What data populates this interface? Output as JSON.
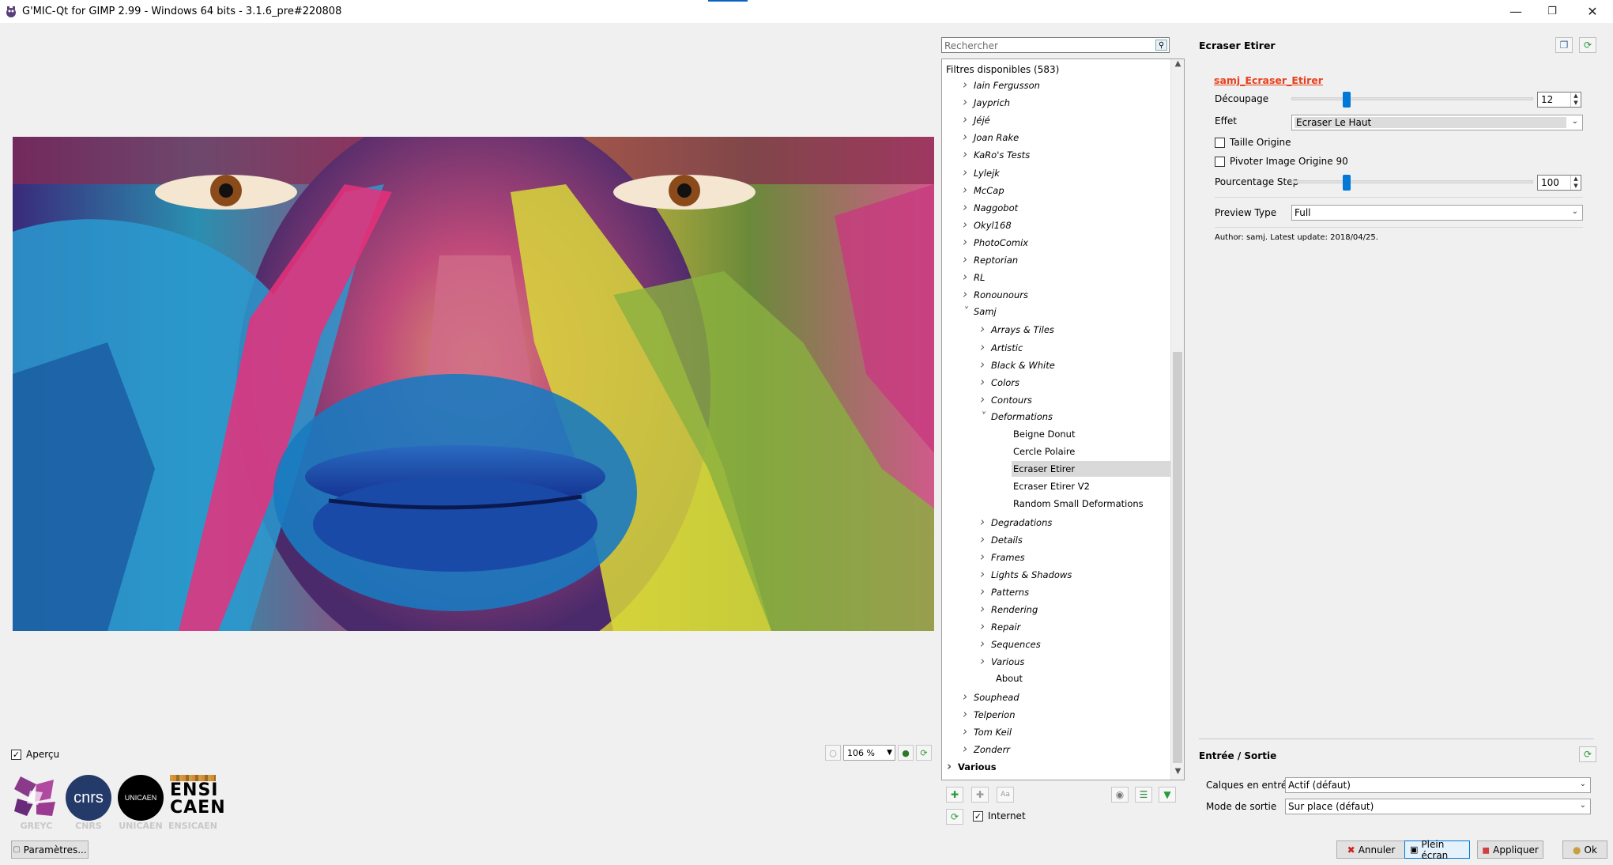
{
  "window": {
    "title": "G'MIC-Qt for GIMP 2.99 - Windows 64 bits - 3.1.6_pre#220808",
    "controls": [
      "minimize",
      "restore",
      "close"
    ]
  },
  "preview": {
    "apercu_label": "Aperçu",
    "apercu_checked": true,
    "zoom": "106 %"
  },
  "logos": {
    "greyc": "GREYC",
    "cnrs_text": "cnrs",
    "cnrs": "CNRS",
    "unicaen_text": "UNICAEN",
    "unicaen": "UNICAEN",
    "ensicaen_line1": "ENSI",
    "ensicaen_line2": "CAEN",
    "ensicaen": "ENSICAEN"
  },
  "buttons": {
    "settings": "Paramètres...",
    "cancel": "Annuler",
    "fullscreen": "Plein écran",
    "apply": "Appliquer",
    "ok": "Ok"
  },
  "filters": {
    "search_placeholder": "Rechercher",
    "header": "Filtres disponibles (583)",
    "internet_label": "Internet",
    "internet_checked": true,
    "rows": [
      {
        "label": "Iain Fergusson",
        "level": 1,
        "state": "collapsed"
      },
      {
        "label": "Jayprich",
        "level": 1,
        "state": "collapsed"
      },
      {
        "label": "Jéjé",
        "level": 1,
        "state": "collapsed"
      },
      {
        "label": "Joan Rake",
        "level": 1,
        "state": "collapsed"
      },
      {
        "label": "KaRo's Tests",
        "level": 1,
        "state": "collapsed"
      },
      {
        "label": "Lylejk",
        "level": 1,
        "state": "collapsed"
      },
      {
        "label": "McCap",
        "level": 1,
        "state": "collapsed"
      },
      {
        "label": "Naggobot",
        "level": 1,
        "state": "collapsed"
      },
      {
        "label": "Okyl168",
        "level": 1,
        "state": "collapsed"
      },
      {
        "label": "PhotoComix",
        "level": 1,
        "state": "collapsed"
      },
      {
        "label": "Reptorian",
        "level": 1,
        "state": "collapsed"
      },
      {
        "label": "RL",
        "level": 1,
        "state": "collapsed"
      },
      {
        "label": "Ronounours",
        "level": 1,
        "state": "collapsed"
      },
      {
        "label": "Samj",
        "level": 1,
        "state": "expanded"
      },
      {
        "label": "Arrays & Tiles",
        "level": 2,
        "state": "collapsed"
      },
      {
        "label": "Artistic",
        "level": 2,
        "state": "collapsed"
      },
      {
        "label": "Black & White",
        "level": 2,
        "state": "collapsed"
      },
      {
        "label": "Colors",
        "level": 2,
        "state": "collapsed"
      },
      {
        "label": "Contours",
        "level": 2,
        "state": "collapsed"
      },
      {
        "label": "Deformations",
        "level": 2,
        "state": "expanded"
      },
      {
        "label": "Beigne Donut",
        "level": 3,
        "state": "leaf"
      },
      {
        "label": "Cercle Polaire",
        "level": 3,
        "state": "leaf"
      },
      {
        "label": "Ecraser Etirer",
        "level": 3,
        "state": "leaf",
        "selected": true
      },
      {
        "label": "Ecraser Etirer V2",
        "level": 3,
        "state": "leaf"
      },
      {
        "label": "Random Small Deformations",
        "level": 3,
        "state": "leaf"
      },
      {
        "label": "Degradations",
        "level": 2,
        "state": "collapsed"
      },
      {
        "label": "Details",
        "level": 2,
        "state": "collapsed"
      },
      {
        "label": "Frames",
        "level": 2,
        "state": "collapsed"
      },
      {
        "label": "Lights & Shadows",
        "level": 2,
        "state": "collapsed"
      },
      {
        "label": "Patterns",
        "level": 2,
        "state": "collapsed"
      },
      {
        "label": "Rendering",
        "level": 2,
        "state": "collapsed"
      },
      {
        "label": "Repair",
        "level": 2,
        "state": "collapsed"
      },
      {
        "label": "Sequences",
        "level": 2,
        "state": "collapsed"
      },
      {
        "label": "Various",
        "level": 2,
        "state": "collapsed"
      },
      {
        "label": "About",
        "level": 2,
        "state": "leaf-plain"
      },
      {
        "label": "Souphead",
        "level": 1,
        "state": "collapsed"
      },
      {
        "label": "Telperion",
        "level": 1,
        "state": "collapsed"
      },
      {
        "label": "Tom Keil",
        "level": 1,
        "state": "collapsed"
      },
      {
        "label": "Zonderr",
        "level": 1,
        "state": "collapsed"
      },
      {
        "label": "Various",
        "level": 0,
        "state": "collapsed"
      }
    ]
  },
  "params": {
    "title": "Ecraser Etirer",
    "command": "samj_Ecraser_Etirer",
    "decoupage_label": "Découpage",
    "decoupage_value": "12",
    "decoupage_fraction": 0.23,
    "effet_label": "Effet",
    "effet_value": "Ecraser Le Haut",
    "taille_label": "Taille Origine",
    "taille_checked": false,
    "pivoter_label": "Pivoter Image Origine 90",
    "pivoter_checked": false,
    "pourcentage_label": "Pourcentage Step",
    "pourcentage_value": "100",
    "pourcentage_fraction": 0.23,
    "preview_type_label": "Preview Type",
    "preview_type_value": "Full",
    "author": "Author: samj. Latest update: 2018/04/25."
  },
  "io": {
    "title": "Entrée / Sortie",
    "input_label": "Calques en entrée",
    "input_value": "Actif (défaut)",
    "output_label": "Mode de sortie",
    "output_value": "Sur place (défaut)"
  },
  "colors": {
    "accent": "#0078d7",
    "link": "#e8401c",
    "selection": "#d9d9d9"
  }
}
